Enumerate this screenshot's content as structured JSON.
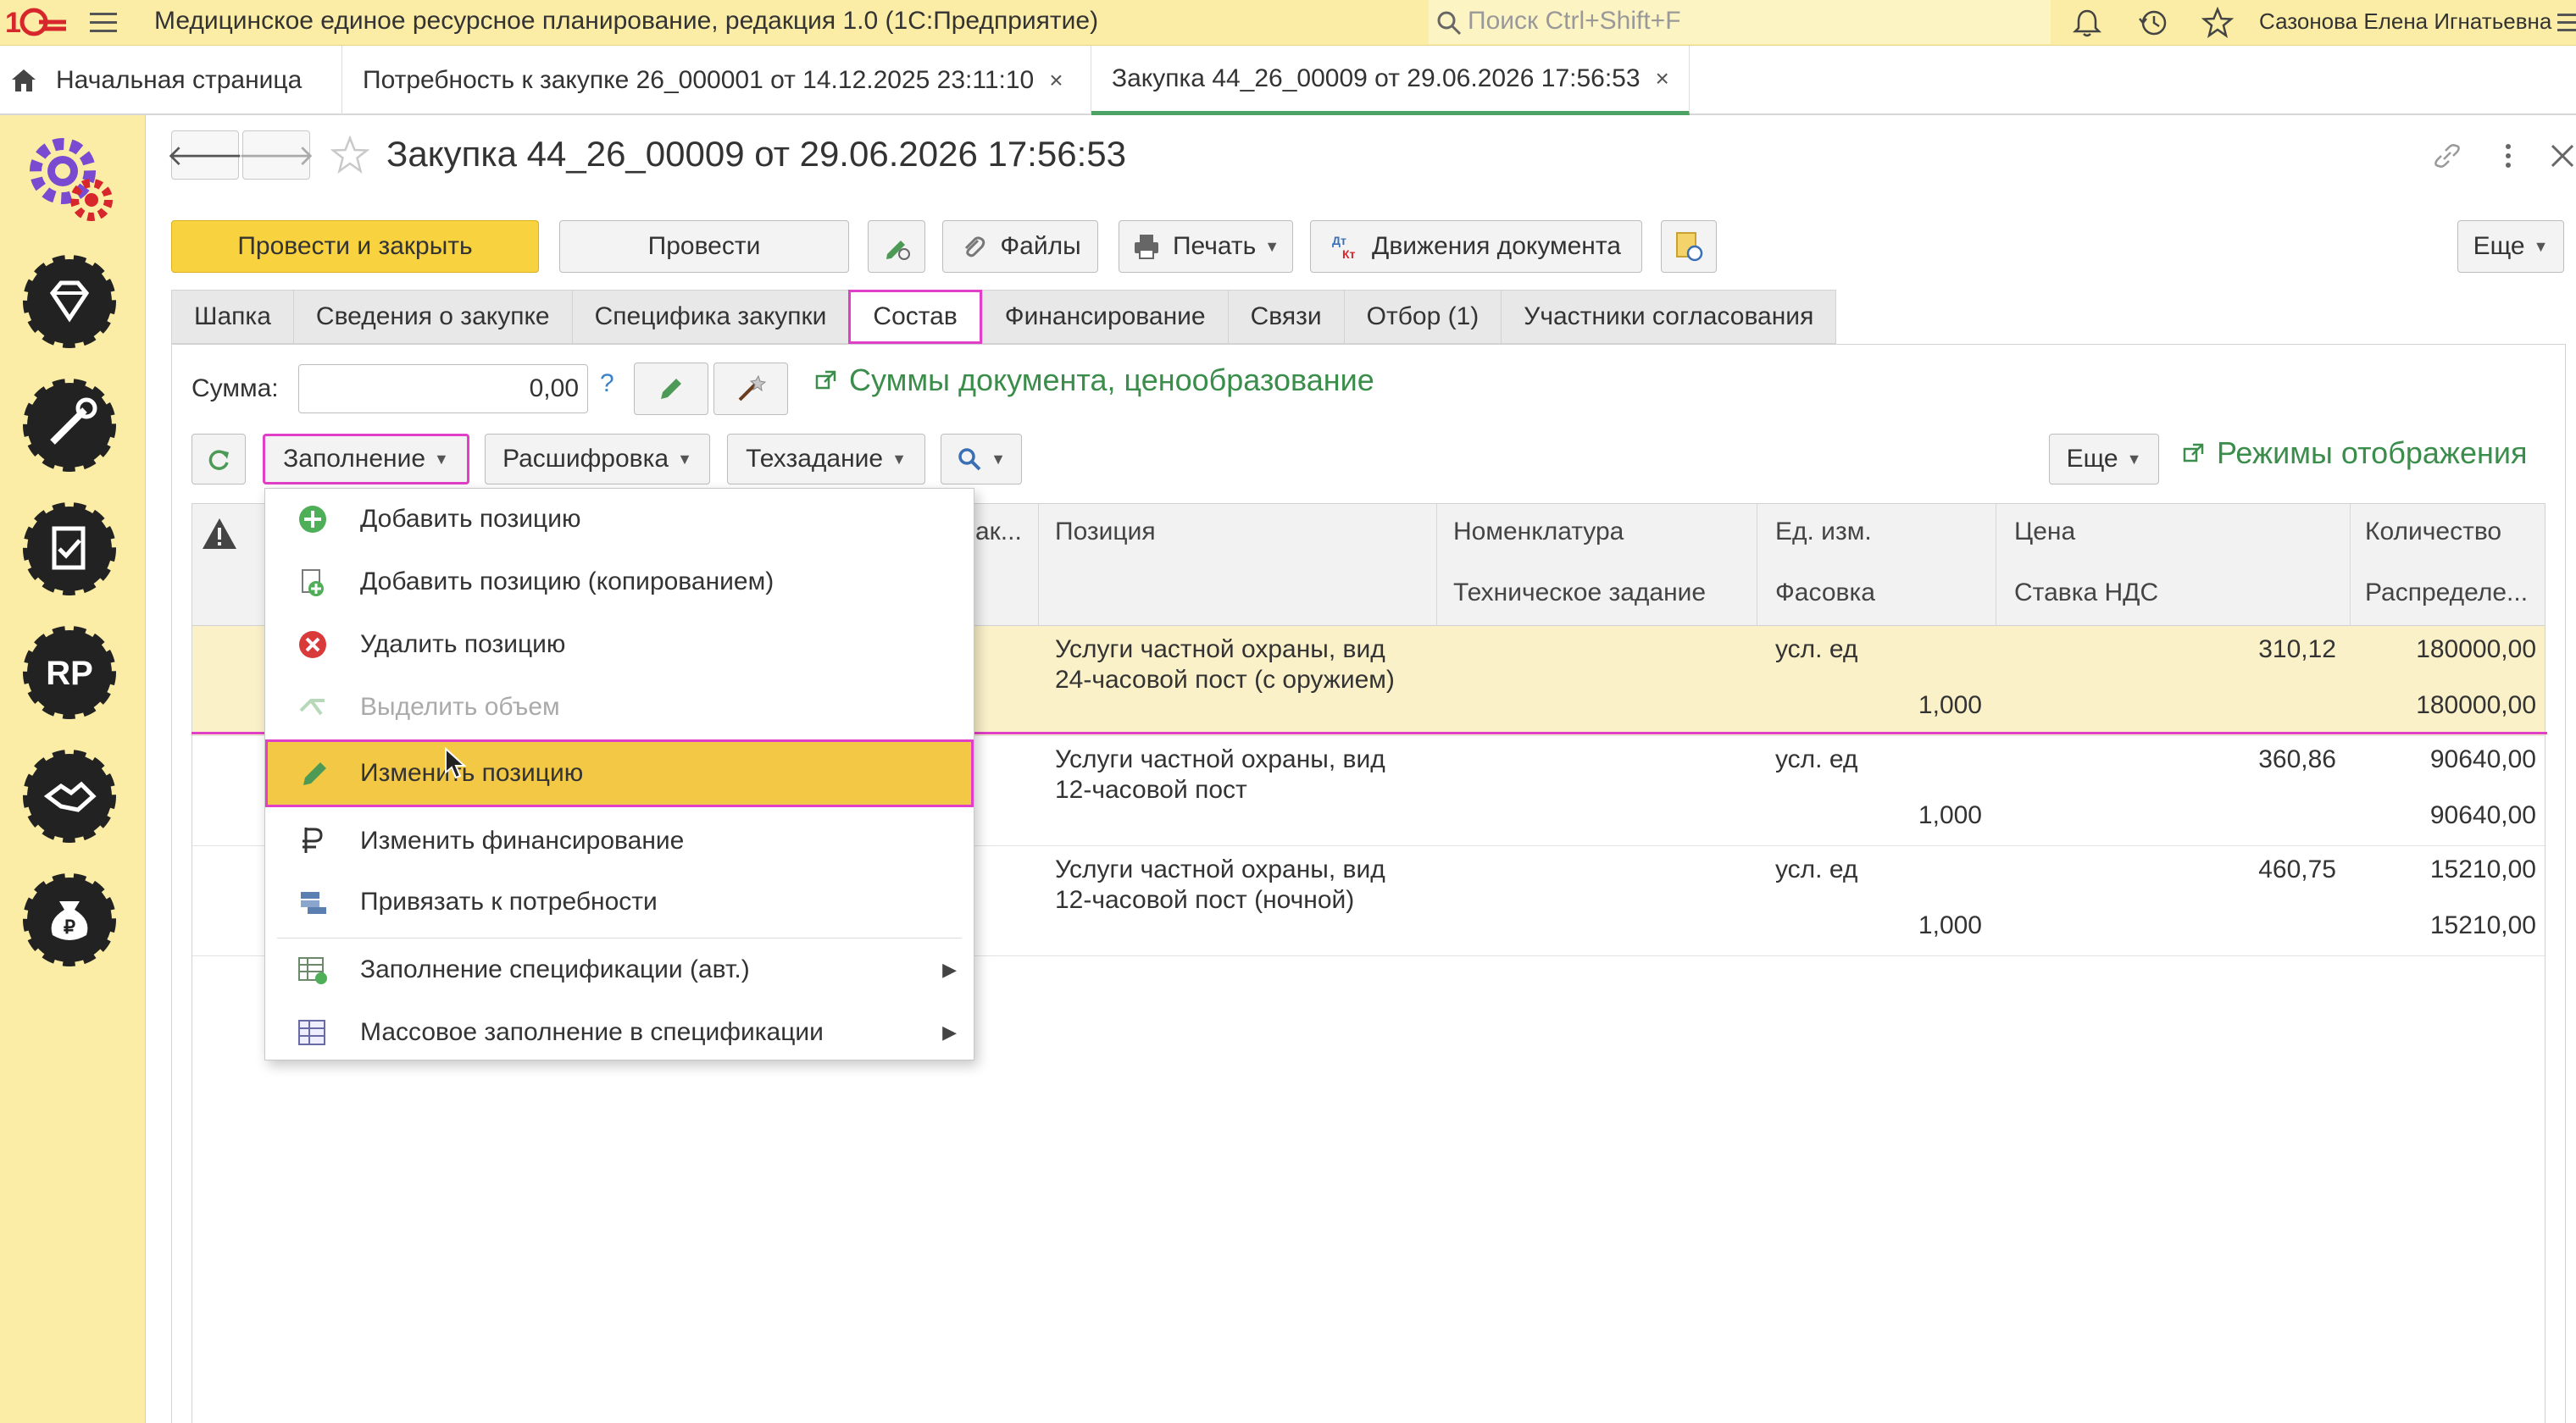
{
  "app": {
    "title": "Медицинское единое ресурсное планирование, редакция 1.0  (1С:Предприятие)",
    "search_placeholder": "Поиск Ctrl+Shift+F",
    "user": "Сазонова Елена Игнатьевна"
  },
  "tabs": {
    "home": "Начальная страница",
    "open": [
      {
        "label": "Потребность к закупке 26_000001 от 14.12.2025 23:11:10"
      },
      {
        "label": "Закупка 44_26_00009 от 29.06.2026 17:56:53"
      }
    ],
    "close_glyph": "×"
  },
  "doc": {
    "title": "Закупка 44_26_00009 от 29.06.2026 17:56:53",
    "back": "🡐",
    "forward": "🡒"
  },
  "toolbar": {
    "post_close": "Провести и закрыть",
    "post": "Провести",
    "files": "Файлы",
    "print": "Печать",
    "movements": "Движения документа",
    "more": "Еще"
  },
  "form_tabs": [
    "Шапка",
    "Сведения о закупке",
    "Специфика закупки",
    "Состав",
    "Финансирование",
    "Связи",
    "Отбор (1)",
    "Участники согласования"
  ],
  "sum": {
    "label": "Сумма:",
    "value": "0,00",
    "help": "?",
    "link": "Суммы документа, ценообразование"
  },
  "table_toolbar": {
    "fill": "Заполнение",
    "decode": "Расшифровка",
    "spec": "Техзадание",
    "more": "Еще",
    "display_modes": "Режимы отображения"
  },
  "grid": {
    "headers": {
      "col_trunc": "ак...",
      "position": "Позиция",
      "nomenclature": "Номенклатура",
      "tech_task": "Техническое задание",
      "unit": "Ед. изм.",
      "packing": "Фасовка",
      "price": "Цена",
      "vat": "Ставка НДС",
      "qty": "Количество",
      "distribution": "Распределе..."
    },
    "rows": [
      {
        "position_l1": "Услуги частной охраны, вид",
        "position_l2": "24-часовой пост (с оружием)",
        "unit": "усл. ед",
        "packing": "1,000",
        "price": "310,12",
        "qty": "180000,00",
        "dist": "180000,00"
      },
      {
        "position_l1": "Услуги частной охраны, вид",
        "position_l2": "12-часовой пост",
        "unit": "усл. ед",
        "packing": "1,000",
        "price": "360,86",
        "qty": "90640,00",
        "dist": "90640,00"
      },
      {
        "position_l1": "Услуги частной охраны, вид",
        "position_l2": "12-часовой пост (ночной)",
        "unit": "усл. ед",
        "packing": "1,000",
        "price": "460,75",
        "qty": "15210,00",
        "dist": "15210,00"
      }
    ]
  },
  "menu": {
    "items": [
      {
        "label": "Добавить позицию",
        "icon": "plus-circle-icon"
      },
      {
        "label": "Добавить позицию (копированием)",
        "icon": "copy-doc-icon"
      },
      {
        "label": "Удалить позицию",
        "icon": "delete-circle-icon"
      },
      {
        "label": "Выделить объем",
        "icon": "split-volume-icon",
        "disabled": true
      },
      {
        "label": "Изменить позицию",
        "icon": "pencil-icon",
        "highlighted": true
      },
      {
        "label": "Изменить финансирование",
        "icon": "ruble-icon"
      },
      {
        "label": "Привязать к потребности",
        "icon": "link-stack-icon"
      },
      {
        "label": "Заполнение спецификации (авт.)",
        "icon": "table-fill-icon",
        "submenu": true
      },
      {
        "label": "Массовое заполнение в спецификации",
        "icon": "table-mass-icon",
        "submenu": true
      }
    ],
    "submenu_arrow": "▶"
  },
  "colors": {
    "accent_yellow": "#fbeda5",
    "primary_button": "#f8d33f",
    "highlight_pink": "#e040c8",
    "link_green": "#3a8d4a",
    "active_tab_underline": "#4ca364"
  }
}
